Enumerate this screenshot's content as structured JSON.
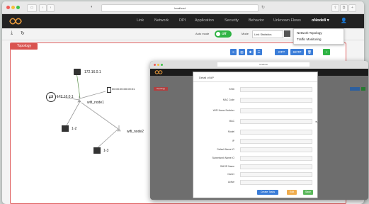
{
  "browser": {
    "url": "localhost",
    "nav_items": [
      "Link",
      "Network",
      "DPI",
      "Application",
      "Security",
      "Behavior",
      "Unknown Flows"
    ],
    "user_menu": "oNode8 ▾"
  },
  "toolbar": {
    "auto_mode_label": "Auto mode",
    "toggle_value": "Off",
    "mode_label": "Mode",
    "mode_value": "Link Statistics"
  },
  "dropdown": {
    "items": [
      "Network Topology",
      "Traffic Monitoring"
    ]
  },
  "topology": {
    "tab_label": "Topology",
    "buttons": [
      "OTP",
      "SCTP"
    ],
    "nodes": {
      "router_top": "172.16.0.1",
      "center": "172.16.0.1",
      "mac": "00:00:00:00:00:01",
      "node1": "wifi_node1",
      "bottom1": "1-2",
      "node2": "wifi_node2",
      "bottom2": "1-3"
    }
  },
  "modal": {
    "title": "Detail of AP",
    "fields": [
      "SSID",
      "MAC Code",
      "WIFI Name Switcher",
      "MAC",
      "Model",
      "IP",
      "Default Name IO",
      "Subnetwork Name IO",
      "SNIOR Name",
      "Owner",
      "Active"
    ],
    "buttons": [
      "Create Tasks",
      "Edit",
      "Save"
    ]
  },
  "second": {
    "url": "localhost",
    "tab": "Topology"
  },
  "colors": {
    "accent": "#d9534f",
    "toggle": "#2fb344",
    "primary": "#3b7dd8",
    "nav": "#222222"
  }
}
